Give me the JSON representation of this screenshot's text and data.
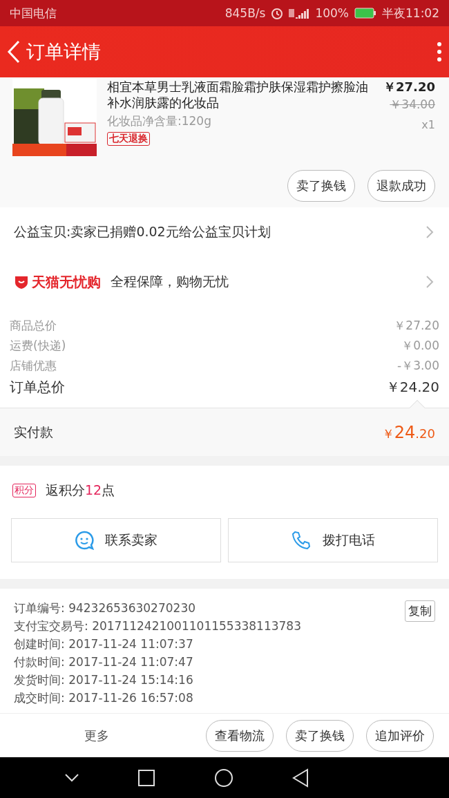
{
  "status_bar": {
    "carrier": "中国电信",
    "speed": "845B/s",
    "battery": "100%",
    "time": "半夜11:02"
  },
  "header": {
    "title": "订单详情"
  },
  "product": {
    "title": "相宜本草男士乳液面霜脸霜护肤保湿霜护擦脸油补水润肤露的化妆品",
    "spec": "化妆品净含量:120g",
    "tag": "七天退换",
    "price": "￥27.20",
    "original_price": "￥34.00",
    "quantity": "x1",
    "image": {
      "kind": "picture"
    },
    "buttons": [
      "卖了换钱",
      "退款成功"
    ]
  },
  "charity": {
    "text": "公益宝贝:卖家已捐赠0.02元给公益宝贝计划"
  },
  "guarantee": {
    "brand": "天猫无忧购",
    "text": "全程保障，购物无忧"
  },
  "costs": [
    {
      "label": "商品总价",
      "value": "￥27.20"
    },
    {
      "label": "运费(快递)",
      "value": "￥0.00"
    },
    {
      "label": "店铺优惠",
      "value": "-￥3.00"
    }
  ],
  "order_total": {
    "label": "订单总价",
    "value": "￥24.20"
  },
  "paid": {
    "label": "实付款",
    "currency": "￥",
    "integer": "24",
    "decimal": ".20"
  },
  "points": {
    "badge": "积分",
    "prefix": "返积分",
    "value": "12",
    "suffix": "点"
  },
  "contact_buttons": [
    {
      "kind": "chat",
      "label": "联系卖家"
    },
    {
      "kind": "phone",
      "label": "拨打电话"
    }
  ],
  "order_info": [
    {
      "label": "订单编号:",
      "value": "94232653630270230"
    },
    {
      "label": "支付宝交易号:",
      "value": "2017112421001101155338113783"
    },
    {
      "label": "创建时间:",
      "value": "2017-11-24 11:07:37"
    },
    {
      "label": "付款时间:",
      "value": "2017-11-24 11:07:47"
    },
    {
      "label": "发货时间:",
      "value": "2017-11-24 15:14:16"
    },
    {
      "label": "成交时间:",
      "value": "2017-11-26 16:57:08"
    }
  ],
  "copy_button": "复制",
  "bottom_bar": {
    "more": "更多",
    "buttons": [
      "查看物流",
      "卖了换钱",
      "追加评价"
    ]
  }
}
